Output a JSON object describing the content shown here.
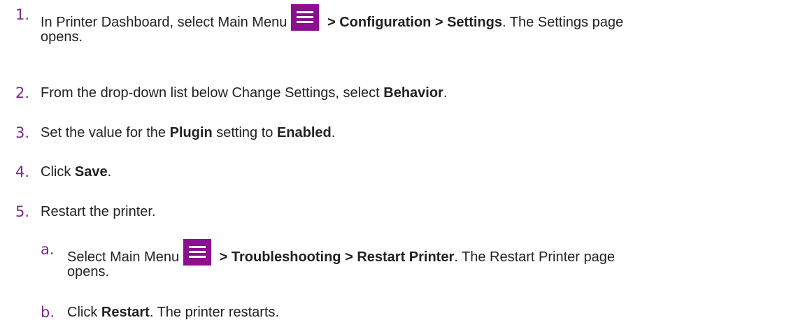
{
  "steps": [
    {
      "num": "1.",
      "line1_pre": "In Printer Dashboard, select Main Menu",
      "icon": "hamburger-menu-icon",
      "line1_bold": " > Configuration > Settings",
      "line1_post": ". The Settings page",
      "line2": "opens."
    },
    {
      "num": "2.",
      "pre": "From the drop-down list below Change Settings, select ",
      "bold": "Behavior",
      "post": "."
    },
    {
      "num": "3.",
      "pre": "Set the value for the ",
      "bold1": "Plugin",
      "mid": " setting to ",
      "bold2": "Enabled",
      "post": "."
    },
    {
      "num": "4.",
      "pre": "Click ",
      "bold": "Save",
      "post": "."
    },
    {
      "num": "5.",
      "text": "Restart the printer."
    }
  ],
  "substeps": [
    {
      "num": "a.",
      "line1_pre": "Select Main Menu",
      "icon": "hamburger-menu-icon",
      "line1_bold": " > Troubleshooting > Restart Printer",
      "line1_post": ". The Restart Printer page",
      "line2": "opens."
    },
    {
      "num": "b.",
      "pre": "Click ",
      "bold": "Restart",
      "post": ". The printer restarts."
    }
  ],
  "colors": {
    "number": "#7b2a8a",
    "menu_icon_bg": "#8b0f8f",
    "text": "#222222"
  }
}
